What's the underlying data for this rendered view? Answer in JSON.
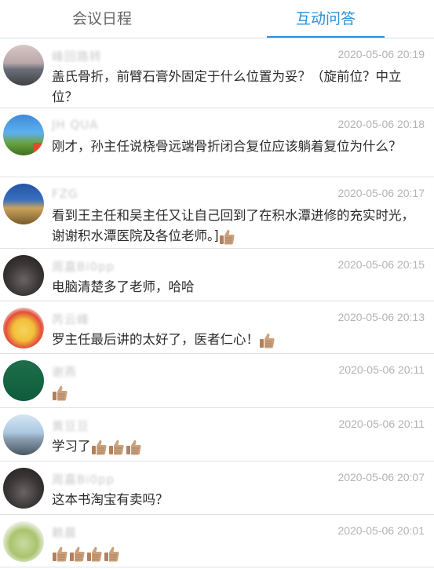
{
  "tabs": {
    "schedule": "会议日程",
    "qa": "互动问答"
  },
  "messages": [
    {
      "nick": "峰回路转",
      "time": "2020-05-06 20:19",
      "text": "盖氏骨折，前臂石膏外固定于什么位置为妥？（旋前位？中立位？",
      "thumbs": 0
    },
    {
      "nick": "JH QUA",
      "time": "2020-05-06 20:18",
      "text": "刚才，孙主任说桡骨远端骨折闭合复位应该躺着复位为什么？",
      "thumbs": 0
    },
    {
      "nick": "FZG",
      "time": "2020-05-06 20:17",
      "text": "看到王主任和吴主任又让自己回到了在积水潭进修的充实时光，谢谢积水潭医院及各位老师。]",
      "thumbs": 1
    },
    {
      "nick": "周嘉Bi0pp",
      "time": "2020-05-06 20:15",
      "text": "电脑清楚多了老师，哈哈",
      "thumbs": 0
    },
    {
      "nick": "芮云峰",
      "time": "2020-05-06 20:13",
      "text": "罗主任最后讲的太好了，医者仁心！",
      "thumbs": 1
    },
    {
      "nick": "谢燕",
      "time": "2020-05-06 20:11",
      "text": "",
      "thumbs": 1
    },
    {
      "nick": "黄豆豆",
      "time": "2020-05-06 20:11",
      "text": "学习了",
      "thumbs": 3
    },
    {
      "nick": "周嘉Bi0pp",
      "time": "2020-05-06 20:07",
      "text": "这本书淘宝有卖吗？",
      "thumbs": 0
    },
    {
      "nick": "赖晨",
      "time": "2020-05-06 20:01",
      "text": "",
      "thumbs": 4
    }
  ]
}
